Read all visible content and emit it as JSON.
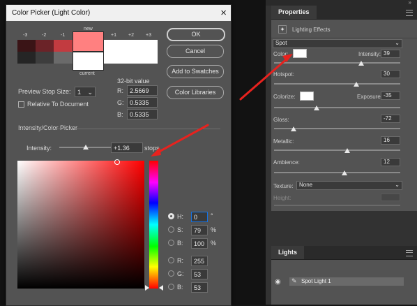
{
  "dialog": {
    "title": "Color Picker (Light Color)",
    "close_glyph": "×",
    "stops": [
      "-3",
      "-2",
      "-1",
      "new",
      "+1",
      "+2",
      "+3"
    ],
    "current_label": "current",
    "preview_label": "Preview Stop Size:",
    "preview_value": "1",
    "relative_label": "Relative To Document",
    "bit_label": "32-bit value",
    "r_label": "R:",
    "r_value": "2.5669",
    "g_label": "G:",
    "g_value": "0.5335",
    "b_label": "B:",
    "b_value": "0.5335",
    "ok_label": "OK",
    "cancel_label": "Cancel",
    "add_label": "Add to Swatches",
    "libraries_label": "Color Libraries",
    "section_label": "Intensity/Color Picker",
    "intensity_label": "Intensity:",
    "intensity_value": "+1.36",
    "stops_label": "stops",
    "h_label": "H:",
    "h_value": "0",
    "h_unit": "°",
    "s_label": "S:",
    "s_value": "79",
    "s_unit": "%",
    "bb_label": "B:",
    "bb_value": "100",
    "bb_unit": "%",
    "rr_label": "R:",
    "rr_value": "255",
    "gg_label": "G:",
    "gg_value": "53",
    "b2_label": "B:",
    "b2_value": "53"
  },
  "colors": {
    "swatch_m3": "#3a1416",
    "swatch_m2": "#6b2328",
    "swatch_m1": "#c23b40",
    "swatch_new": "#ff8080",
    "swatch_p1": "#ffffff",
    "swatch_p2": "#ffffff",
    "swatch_p3": "#ffffff",
    "swatch_bot_m3": "#252525",
    "swatch_bot_m2": "#3d3d3d",
    "swatch_bot_m1": "#6a6a6a",
    "hue": "#ff0000",
    "accent": "#1473e6",
    "arrow": "#e8221e"
  },
  "properties": {
    "tab": "Properties",
    "effect_label": "Lighting Effects",
    "light_type": "Spot",
    "color_label": "Color:",
    "intensity_label": "Intensity:",
    "intensity_value": "39",
    "hotspot_label": "Hotspot:",
    "hotspot_value": "30",
    "colorize_label": "Colorize:",
    "exposure_label": "Exposure:",
    "exposure_value": "-35",
    "gloss_label": "Gloss:",
    "gloss_value": "-72",
    "metallic_label": "Metallic:",
    "metallic_value": "16",
    "ambience_label": "Ambience:",
    "ambience_value": "12",
    "texture_label": "Texture:",
    "texture_value": "None",
    "height_label": "Height:"
  },
  "lights": {
    "tab": "Lights",
    "item": "Spot Light 1"
  }
}
